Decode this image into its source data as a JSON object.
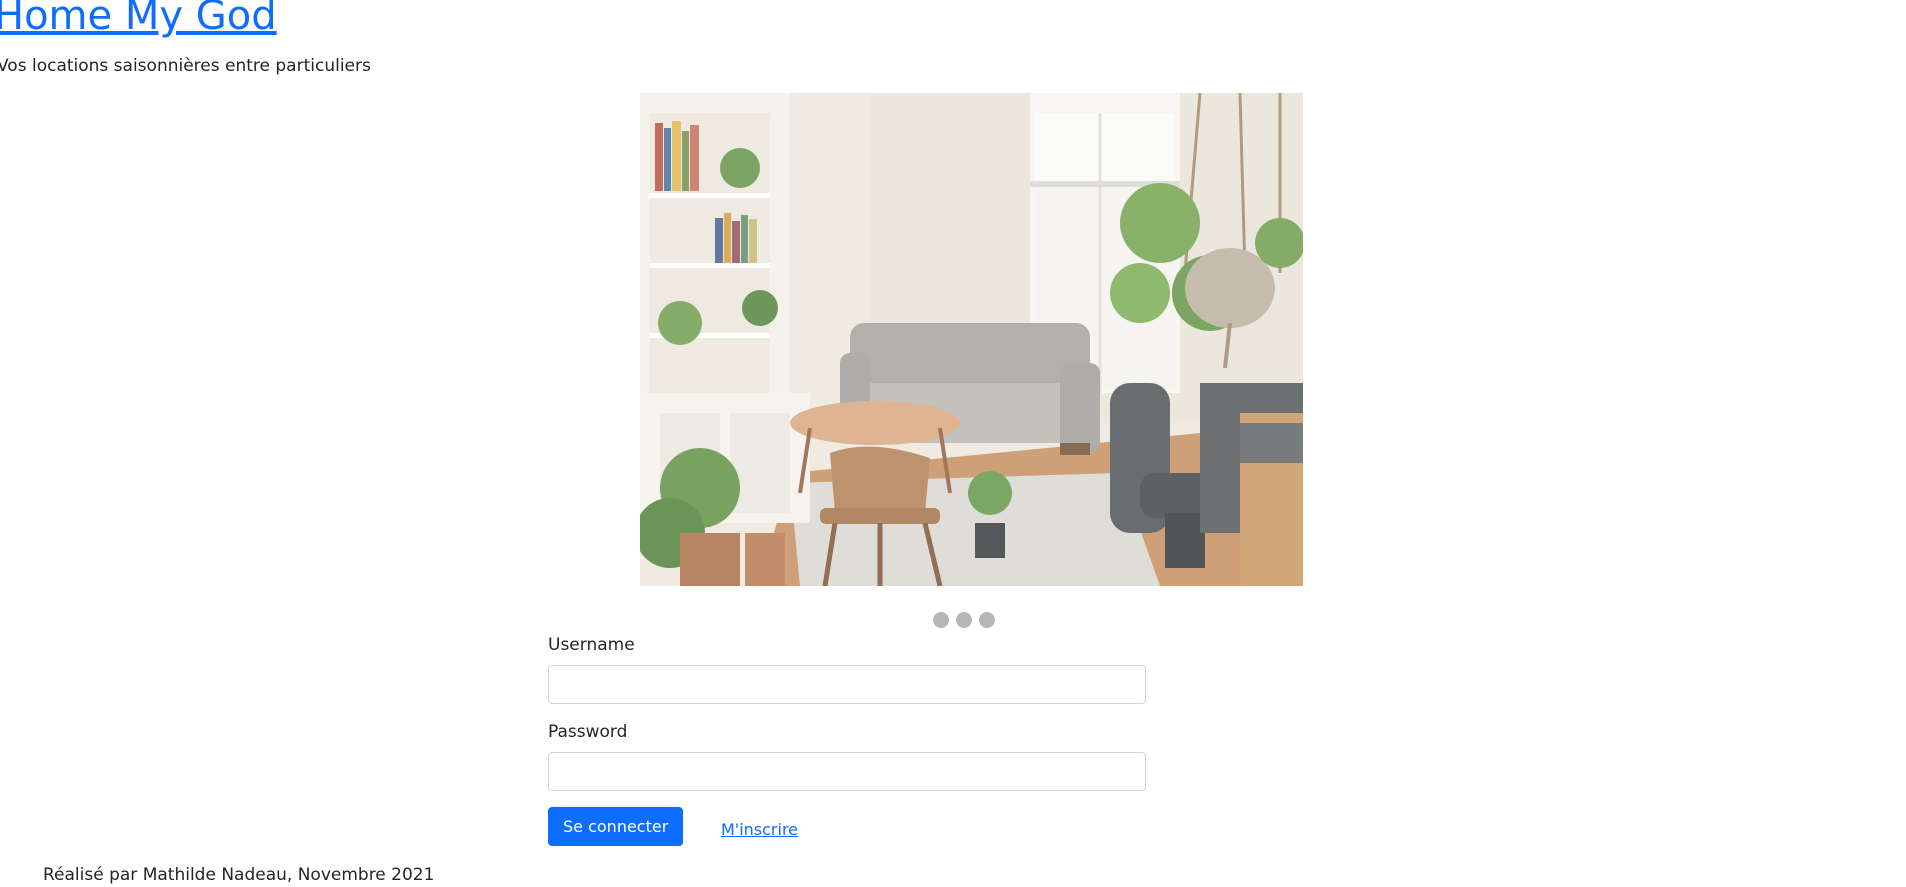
{
  "header": {
    "title": "Home My God",
    "tagline": "Vos locations saisonnières entre particuliers"
  },
  "carousel": {
    "slide_count": 3,
    "active_slide": 1,
    "slide_image": "living-room-with-sofa-plants-and-bookshelf"
  },
  "login_form": {
    "username_label": "Username",
    "username_value": "",
    "password_label": "Password",
    "password_value": "",
    "submit_label": "Se connecter",
    "register_label": "M'inscrire"
  },
  "footer": {
    "credit": "Réalisé par Mathilde Nadeau, Novembre 2021"
  },
  "colors": {
    "link": "#0d6efd",
    "primary_button": "#0d6efd",
    "dot": "#b7b7b7",
    "input_border": "#ced4da"
  }
}
